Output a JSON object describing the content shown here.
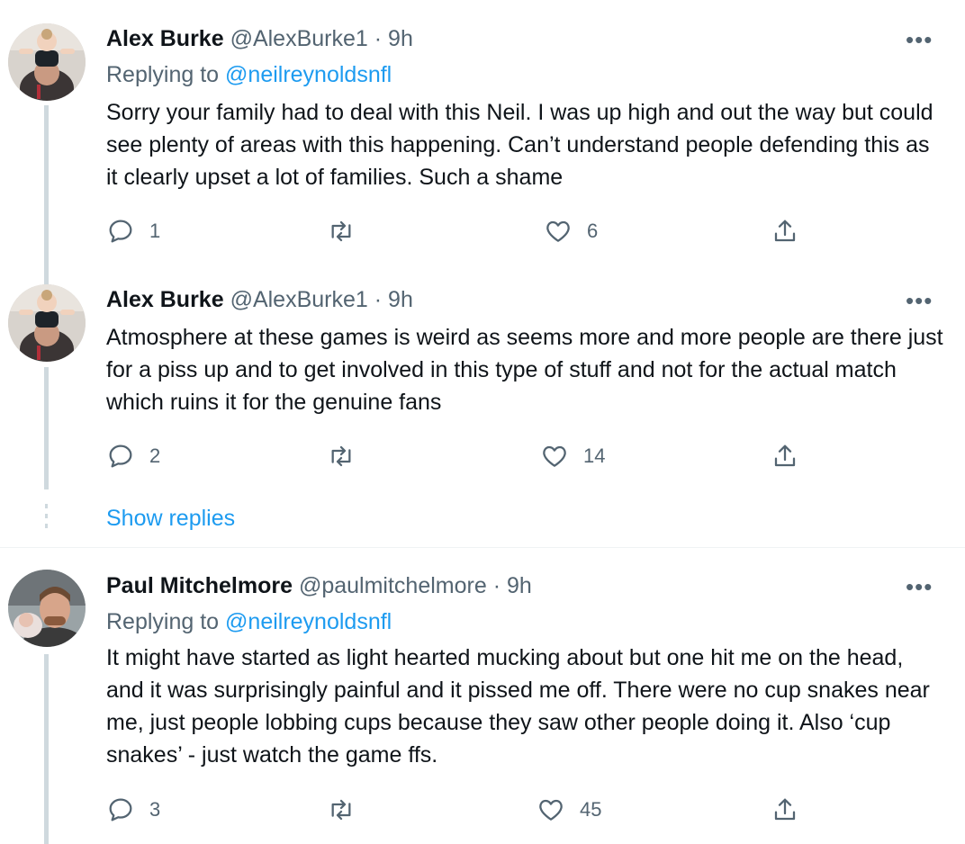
{
  "tweets": [
    {
      "name": "Alex Burke",
      "handle": "@AlexBurke1",
      "time": "9h",
      "replying_prefix": "Replying to ",
      "replying_to": "@neilreynoldsnfl",
      "text": "Sorry your family had to deal with this Neil. I was up high and out the way but could see plenty of areas with this happening. Can’t understand people defending this as it clearly upset a lot of families. Such a shame",
      "replies": "1",
      "retweets": "",
      "likes": "6"
    },
    {
      "name": "Alex Burke",
      "handle": "@AlexBurke1",
      "time": "9h",
      "text": "Atmosphere at these games is weird as seems more and more people are there just for a piss up and to get involved in this type of stuff and not for the actual match which ruins it for the genuine fans",
      "replies": "2",
      "retweets": "",
      "likes": "14"
    },
    {
      "name": "Paul Mitchelmore",
      "handle": "@paulmitchelmore",
      "time": "9h",
      "replying_prefix": "Replying to ",
      "replying_to": "@neilreynoldsnfl",
      "text": "It might have started as light hearted mucking about but one hit me on the head, and it was surprisingly painful and it pissed me off. There were no cup snakes near me, just people lobbing cups because they saw other people doing it. Also ‘cup snakes’ - just watch the game ffs.",
      "replies": "3",
      "retweets": "",
      "likes": "45"
    }
  ],
  "show_replies": "Show replies",
  "dot_separator": "·",
  "more_glyph": "•••",
  "icons": {
    "reply": "reply-icon",
    "retweet": "retweet-icon",
    "like": "heart-icon",
    "share": "share-icon",
    "more": "more-icon"
  },
  "colors": {
    "link": "#1d9bf0",
    "secondary": "#536471",
    "thread_line": "#cfd9de"
  }
}
